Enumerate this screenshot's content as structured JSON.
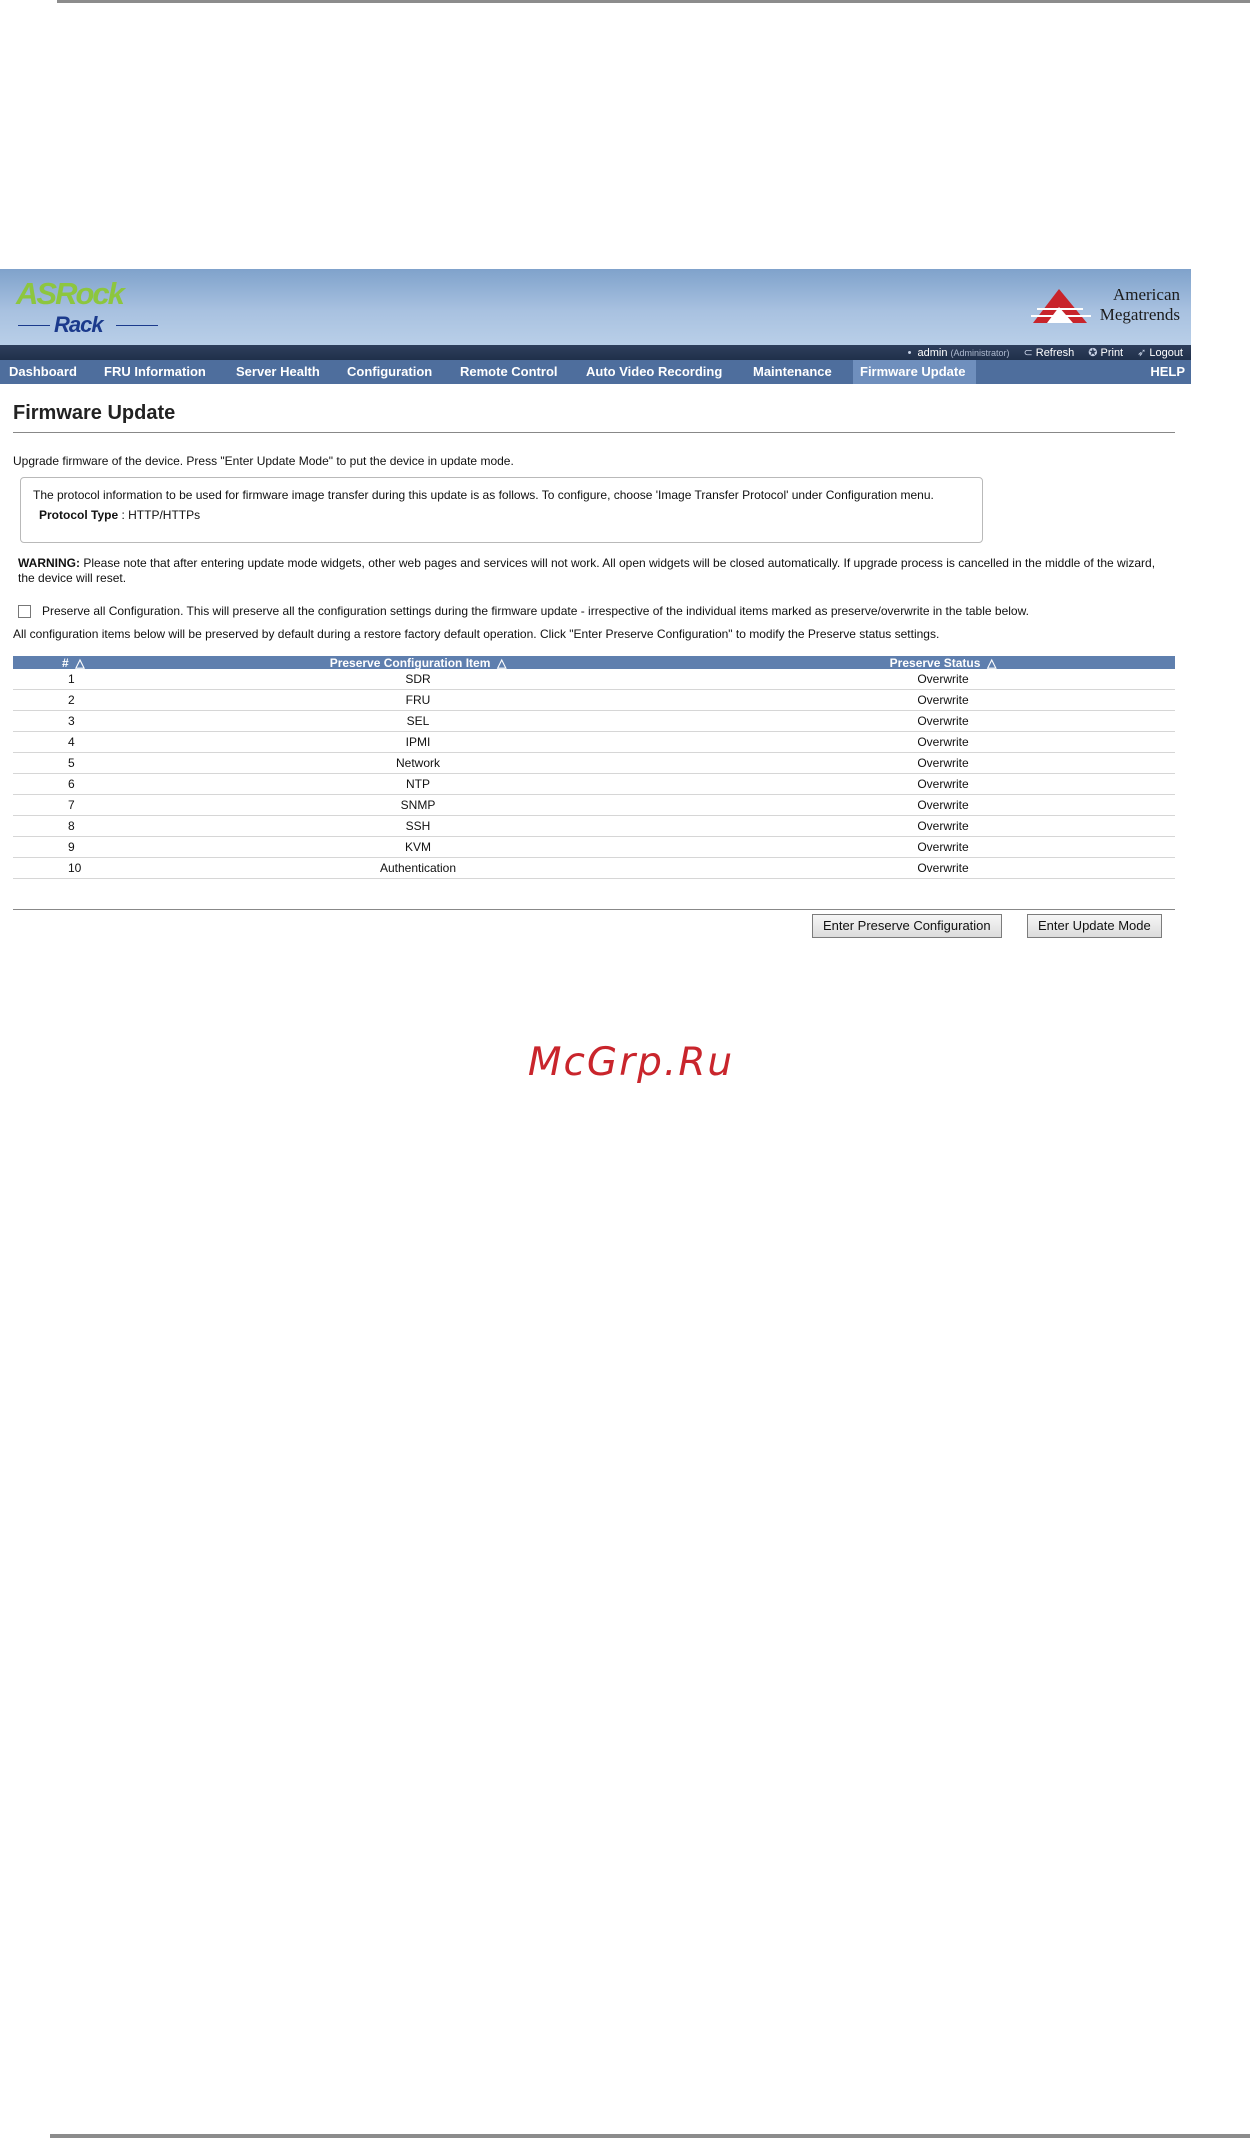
{
  "header": {
    "logo_top": "ASRock",
    "logo_bottom": "Rack",
    "ami_line1": "American",
    "ami_line2": "Megatrends"
  },
  "userbar": {
    "user": "admin",
    "role": "(Administrator)",
    "refresh": "Refresh",
    "print": "Print",
    "logout": "Logout"
  },
  "nav": {
    "items": [
      {
        "label": "Dashboard"
      },
      {
        "label": "FRU Information"
      },
      {
        "label": "Server Health"
      },
      {
        "label": "Configuration"
      },
      {
        "label": "Remote Control"
      },
      {
        "label": "Auto Video Recording"
      },
      {
        "label": "Maintenance"
      },
      {
        "label": "Firmware Update"
      }
    ],
    "active": "Firmware Update",
    "help": "HELP"
  },
  "page": {
    "title": "Firmware Update",
    "description": "Upgrade firmware of the device. Press \"Enter Update Mode\" to put the device in update mode.",
    "protocol_info": "The protocol information to be used for firmware image transfer during this update is as follows. To configure, choose 'Image Transfer Protocol' under Configuration menu.",
    "protocol_label": "Protocol Type",
    "protocol_value": ": HTTP/HTTPs",
    "warning_label": "WARNING:",
    "warning_text": " Please note that after entering update mode widgets, other web pages and services will not work. All open widgets will be closed automatically. If upgrade process is cancelled in the middle of the wizard, the device will reset.",
    "preserve_all": "Preserve all Configuration. This will preserve all the configuration settings during the firmware update - irrespective of the individual items marked as preserve/overwrite in the table below.",
    "preserve_all_checked": false,
    "note": "All configuration items below will be preserved by default during a restore factory default operation. Click \"Enter Preserve Configuration\" to modify the Preserve status settings."
  },
  "table": {
    "headers": [
      "#",
      "Preserve Configuration Item",
      "Preserve Status"
    ],
    "sort_glyph": "△",
    "rows": [
      {
        "num": "1",
        "item": "SDR",
        "status": "Overwrite"
      },
      {
        "num": "2",
        "item": "FRU",
        "status": "Overwrite"
      },
      {
        "num": "3",
        "item": "SEL",
        "status": "Overwrite"
      },
      {
        "num": "4",
        "item": "IPMI",
        "status": "Overwrite"
      },
      {
        "num": "5",
        "item": "Network",
        "status": "Overwrite"
      },
      {
        "num": "6",
        "item": "NTP",
        "status": "Overwrite"
      },
      {
        "num": "7",
        "item": "SNMP",
        "status": "Overwrite"
      },
      {
        "num": "8",
        "item": "SSH",
        "status": "Overwrite"
      },
      {
        "num": "9",
        "item": "KVM",
        "status": "Overwrite"
      },
      {
        "num": "10",
        "item": "Authentication",
        "status": "Overwrite"
      }
    ]
  },
  "buttons": {
    "preserve": "Enter Preserve Configuration",
    "update": "Enter Update Mode"
  },
  "watermark": "McGrp.Ru",
  "colors": {
    "nav_bg": "#4e6e9d",
    "nav_active": "#6f8fbd",
    "table_header": "#5f7fae",
    "brand_green": "#8dc63f",
    "brand_blue": "#1b3a8c",
    "watermark": "#c9252c"
  }
}
